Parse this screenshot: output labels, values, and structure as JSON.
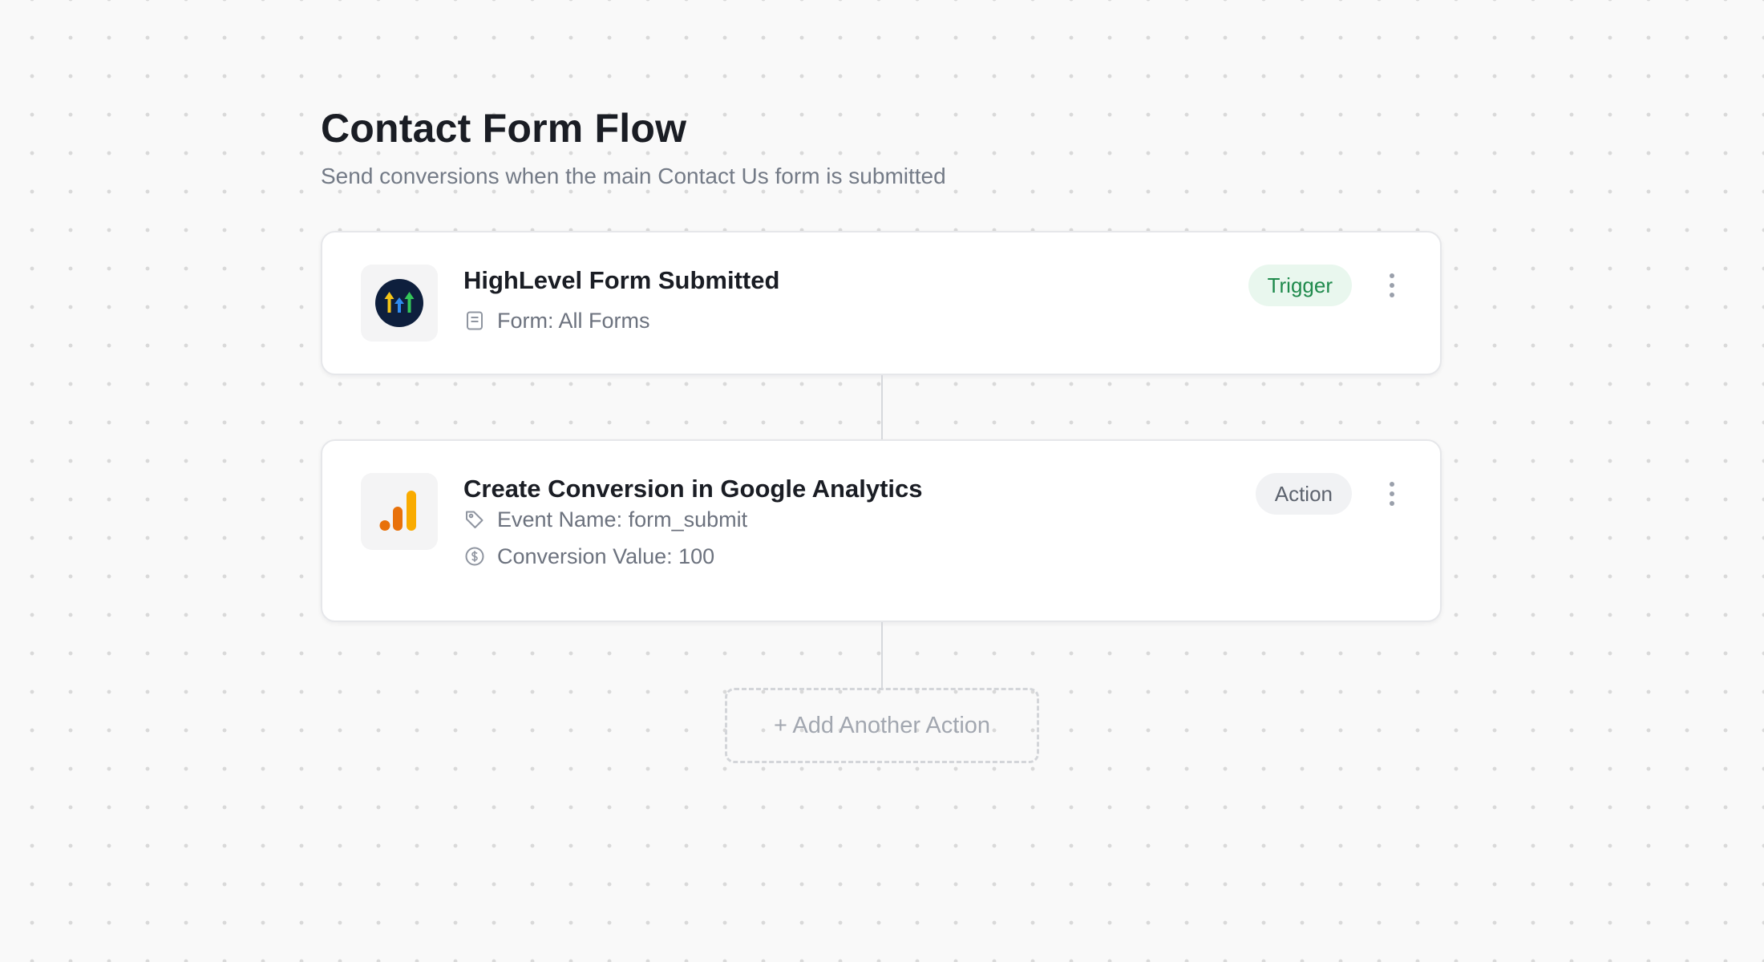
{
  "flow": {
    "title": "Contact Form Flow",
    "description": "Send conversions when the main Contact Us form is submitted"
  },
  "steps": [
    {
      "app_icon": "highlevel-logo-icon",
      "title": "HighLevel Form Submitted",
      "badge": "Trigger",
      "details": [
        {
          "icon": "form-icon",
          "text": "Form: All Forms"
        }
      ]
    },
    {
      "app_icon": "google-analytics-logo-icon",
      "title": "Create Conversion in Google Analytics",
      "badge": "Action",
      "details": [
        {
          "icon": "tag-icon",
          "text": "Event Name: form_submit"
        },
        {
          "icon": "dollar-circle-icon",
          "text": "Conversion Value: 100"
        }
      ]
    }
  ],
  "add_action_label": "+ Add Another Action",
  "colors": {
    "trigger_badge_bg": "#e9f7ee",
    "trigger_badge_text": "#1f8a4c",
    "action_badge_bg": "#f1f2f4",
    "action_badge_text": "#5d636e",
    "highlevel_bg": "#0e1f3d",
    "ga_orange_dark": "#e8710a",
    "ga_orange_light": "#f9ab00"
  }
}
